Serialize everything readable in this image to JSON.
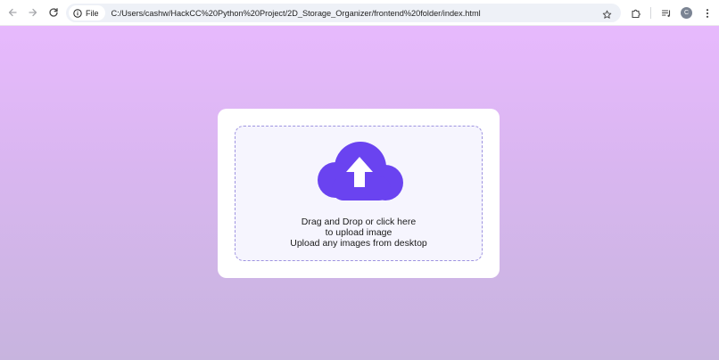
{
  "browser": {
    "chip_label": "File",
    "url": "C:/Users/cashw/HackCC%20Python%20Project/2D_Storage_Organizer/frontend%20folder/index.html",
    "avatar_letter": "C"
  },
  "upload": {
    "line1": "Drag and Drop or click here",
    "line2": "to upload image",
    "line3": "Upload any images from desktop"
  },
  "colors": {
    "cloud": "#6a43f0",
    "dropzone_border": "#9e94e0",
    "background_top": "#e7b9fd",
    "background_bottom": "#c7b4de"
  }
}
